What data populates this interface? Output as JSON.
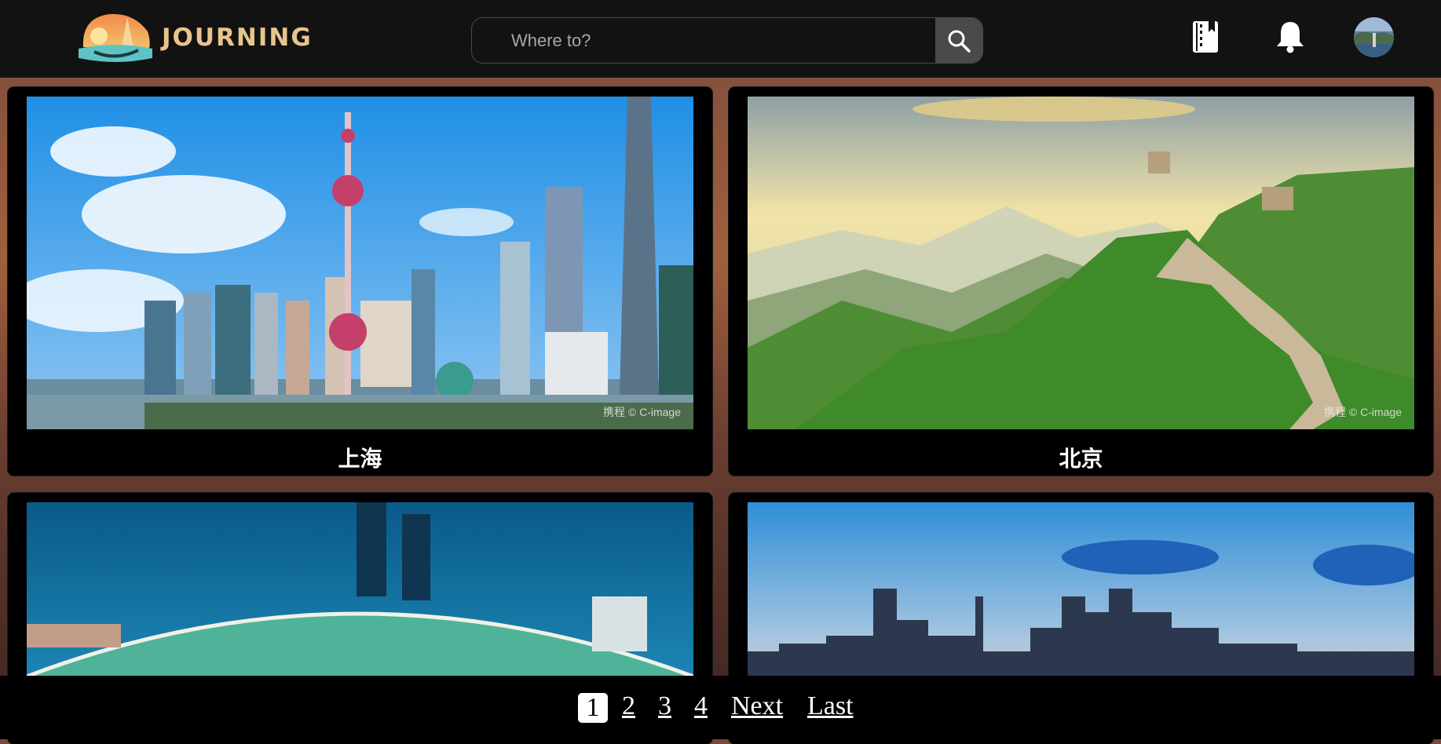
{
  "header": {
    "logo_text": "JOURNING",
    "search": {
      "placeholder": "Where to?"
    },
    "icons": [
      "bookmark-book-icon",
      "bell-icon",
      "search-icon"
    ]
  },
  "cards": [
    {
      "title": "上海",
      "watermark": "携程 © C-image"
    },
    {
      "title": "北京",
      "watermark": "携程 © C-image"
    },
    {
      "title": "",
      "watermark": ""
    },
    {
      "title": "",
      "watermark": ""
    }
  ],
  "pagination": {
    "pages": [
      "1",
      "2",
      "3",
      "4"
    ],
    "current": "1",
    "next_label": "Next",
    "last_label": "Last"
  },
  "colors": {
    "header_bg": "#121212",
    "logo_gold": "#e7c58a",
    "search_button": "#4a4a4a"
  }
}
